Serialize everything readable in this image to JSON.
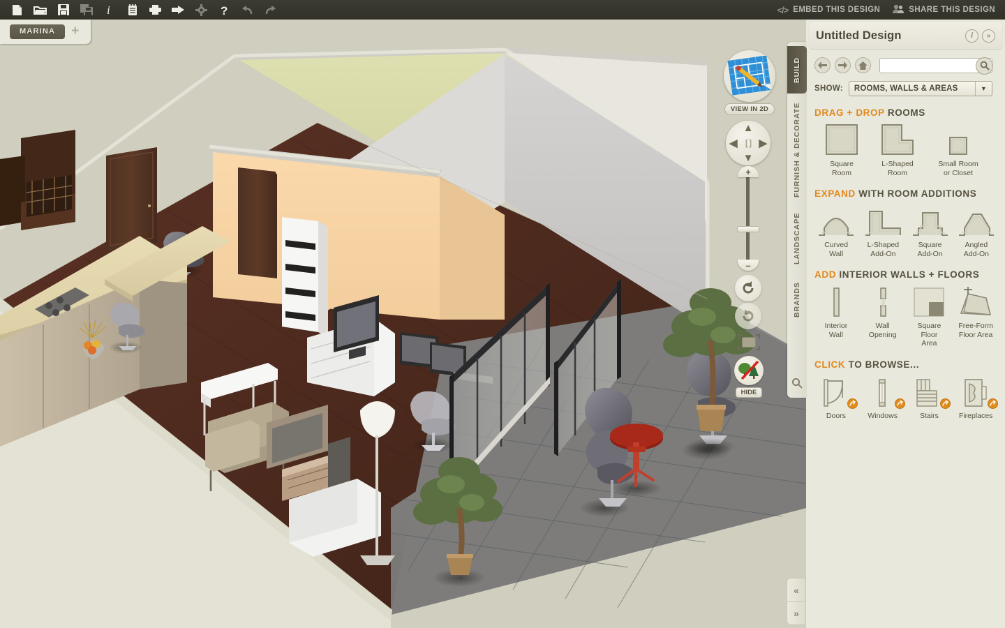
{
  "toolbar": {
    "icons": [
      {
        "name": "new-file-icon",
        "label": "New"
      },
      {
        "name": "open-folder-icon",
        "label": "Open"
      },
      {
        "name": "save-icon",
        "label": "Save"
      },
      {
        "name": "save-as-icon",
        "label": "Save As"
      },
      {
        "name": "info-icon",
        "label": "Info"
      },
      {
        "name": "notes-icon",
        "label": "Notes"
      },
      {
        "name": "print-icon",
        "label": "Print"
      },
      {
        "name": "export-icon",
        "label": "Export"
      },
      {
        "name": "settings-gear-icon",
        "label": "Settings"
      },
      {
        "name": "help-icon",
        "label": "Help"
      },
      {
        "name": "undo-icon",
        "label": "Undo"
      },
      {
        "name": "redo-icon",
        "label": "Redo"
      }
    ],
    "embed_label": "EMBED THIS DESIGN",
    "share_label": "SHARE THIS DESIGN",
    "code_glyph": "</>"
  },
  "project_tabs": {
    "active_tab": "MARINA",
    "add_label": "+"
  },
  "viewport": {
    "view_2d_label": "VIEW IN 2D",
    "hide_label": "HIDE",
    "dpad": {
      "up": "▲",
      "down": "▼",
      "left": "◀",
      "right": "▶",
      "center": "[ ]"
    },
    "zoom": {
      "plus": "+",
      "minus": "–"
    }
  },
  "rail": {
    "tabs": [
      {
        "label": "BUILD",
        "active": true
      },
      {
        "label": "FURNISH & DECORATE",
        "active": false
      },
      {
        "label": "LANDSCAPE",
        "active": false
      },
      {
        "label": "BRANDS",
        "active": false
      }
    ]
  },
  "panel": {
    "title": "Untitled Design",
    "info_btn": "i",
    "collapse_btn": "»",
    "search": {
      "value": "",
      "placeholder": ""
    },
    "show": {
      "label": "SHOW:",
      "value": "ROOMS, WALLS & AREAS"
    },
    "sections": [
      {
        "name": "drag-drop-rooms",
        "head_highlight": "DRAG + DROP ",
        "head_rest": "ROOMS",
        "items": [
          {
            "icon": "square-room-icon",
            "label": "Square\nRoom"
          },
          {
            "icon": "l-shaped-room-icon",
            "label": "L-Shaped\nRoom"
          },
          {
            "icon": "small-room-icon",
            "label": "Small Room\nor Closet"
          }
        ]
      },
      {
        "name": "room-additions",
        "head_highlight": "EXPAND ",
        "head_rest": "WITH ROOM ADDITIONS",
        "items": [
          {
            "icon": "curved-wall-icon",
            "label": "Curved\nWall"
          },
          {
            "icon": "l-shaped-addon-icon",
            "label": "L-Shaped\nAdd-On"
          },
          {
            "icon": "square-addon-icon",
            "label": "Square\nAdd-On"
          },
          {
            "icon": "angled-addon-icon",
            "label": "Angled\nAdd-On"
          }
        ]
      },
      {
        "name": "interior-walls-floors",
        "head_highlight": "ADD ",
        "head_rest": "INTERIOR WALLS + FLOORS",
        "items": [
          {
            "icon": "interior-wall-icon",
            "label": "Interior\nWall"
          },
          {
            "icon": "wall-opening-icon",
            "label": "Wall\nOpening"
          },
          {
            "icon": "square-floor-area-icon",
            "label": "Square Floor\nArea"
          },
          {
            "icon": "free-form-floor-area-icon",
            "label": "Free-Form\nFloor Area"
          }
        ]
      },
      {
        "name": "click-to-browse",
        "head_highlight": "CLICK ",
        "head_rest": "TO BROWSE...",
        "items": [
          {
            "icon": "doors-icon",
            "label": "Doors",
            "badge": true
          },
          {
            "icon": "windows-icon",
            "label": "Windows",
            "badge": true
          },
          {
            "icon": "stairs-icon",
            "label": "Stairs",
            "badge": true
          },
          {
            "icon": "fireplaces-icon",
            "label": "Fireplaces",
            "badge": true
          }
        ]
      }
    ]
  },
  "collapse": {
    "left": "«",
    "right": "»"
  },
  "colors": {
    "accent_orange": "#e08a1e",
    "panel_bg": "#e9e8dd",
    "toolbar_bg": "#37362e",
    "viewport_bg": "#d0cebe",
    "active_tab": "#5b5548"
  }
}
